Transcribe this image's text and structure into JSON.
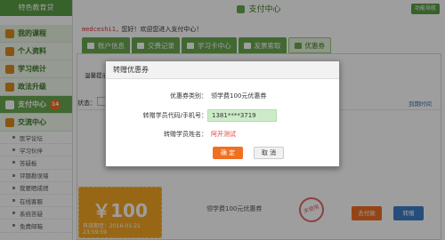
{
  "sidebar": {
    "header": "特色教育贷",
    "top_item": "我的课程",
    "items": [
      {
        "label": "个人资料"
      },
      {
        "label": "学习统计"
      },
      {
        "label": "政法升级"
      },
      {
        "label": "支付中心",
        "badge": "14"
      },
      {
        "label": "交流中心"
      }
    ],
    "subitems": [
      "医学论坛",
      "学习伙伴",
      "答疑板",
      "评题勘误墙",
      "我要晒成绩",
      "在线客服",
      "系统答疑",
      "免费邮箱"
    ]
  },
  "header": {
    "title": "支付中心",
    "function_nav": "功能导航"
  },
  "welcome": {
    "user": "medceshi1,",
    "text": "您好！欢迎您进入支付中心！"
  },
  "tabs": [
    "账户信息",
    "交费记录",
    "学习卡中心",
    "发票索取",
    "优惠券"
  ],
  "content": {
    "notice": "温馨提示",
    "status_label": "状态：",
    "list_link": "到期时间"
  },
  "coupon": {
    "amount": "￥100",
    "expire": "有效期至：2016-01-21 23:59:59",
    "name": "领学费100元优惠券",
    "stamp": "未使用",
    "use_label": "去付款",
    "transfer_label": "转赠"
  },
  "modal": {
    "title": "转赠优惠券",
    "rows": [
      {
        "label": "优惠券类别：",
        "value": "领学费100元优惠券"
      },
      {
        "label": "转赠学员代码/手机号：",
        "value": "1381****3719"
      },
      {
        "label": "转赠学员姓名：",
        "value": "阿开测试"
      }
    ],
    "ok": "确 定",
    "cancel": "取 消"
  },
  "colors": {
    "primary_green": "#6aa84f",
    "accent_orange": "#f07022",
    "coupon_yellow": "#f6a623",
    "overlay": "rgba(0,0,0,0.38)"
  }
}
